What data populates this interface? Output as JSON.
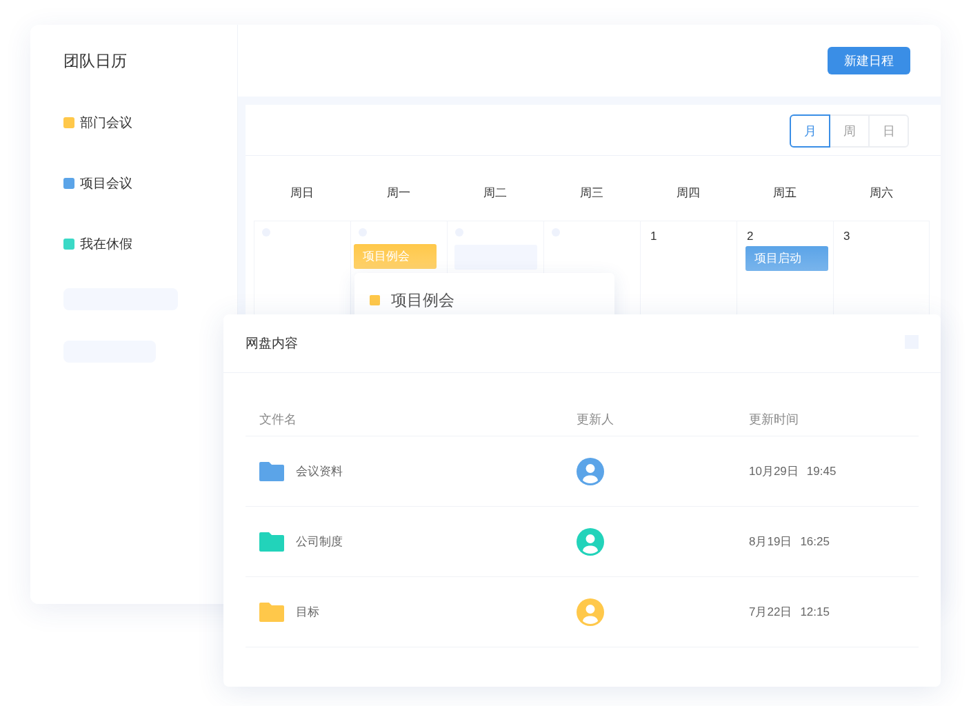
{
  "sidebar": {
    "title": "团队日历",
    "categories": [
      {
        "label": "部门会议",
        "color": "#ffc84a"
      },
      {
        "label": "项目会议",
        "color": "#5ba4e8"
      },
      {
        "label": "我在休假",
        "color": "#3ad9c6"
      }
    ]
  },
  "header": {
    "new_event_button": "新建日程"
  },
  "calendar": {
    "views": [
      {
        "label": "月",
        "selected": true
      },
      {
        "label": "周",
        "selected": false
      },
      {
        "label": "日",
        "selected": false
      }
    ],
    "weekdays": [
      "周日",
      "周一",
      "周二",
      "周三",
      "周四",
      "周五",
      "周六"
    ],
    "days": [
      {
        "kind": "empty"
      },
      {
        "kind": "empty",
        "events": [
          {
            "kind": "event",
            "title": "项目例会",
            "color": "#ffc84a",
            "popover": {
              "title": "项目例会"
            }
          }
        ]
      },
      {
        "kind": "empty",
        "events": [
          {
            "kind": "placeholder"
          }
        ]
      },
      {
        "kind": "empty"
      },
      {
        "kind": "date",
        "date": "1"
      },
      {
        "kind": "date",
        "date": "2",
        "events": [
          {
            "kind": "event",
            "title": "项目启动",
            "color": "#5ba4e8"
          }
        ]
      },
      {
        "kind": "date",
        "date": "3"
      }
    ]
  },
  "files_panel": {
    "title": "网盘内容",
    "columns": [
      "文件名",
      "更新人",
      "更新时间"
    ],
    "rows": [
      {
        "name": "会议资料",
        "color": "#5ba4e8",
        "date": "10月29日",
        "time": "19:45"
      },
      {
        "name": "公司制度",
        "color": "#22d3ba",
        "date": "8月19日",
        "time": "16:25"
      },
      {
        "name": "目标",
        "color": "#ffc84a",
        "date": "7月22日",
        "time": "12:15"
      }
    ]
  }
}
